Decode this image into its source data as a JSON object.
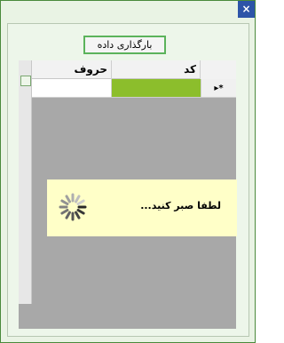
{
  "titlebar": {
    "close_symbol": "×"
  },
  "toolbar": {
    "load_data_label": "بارگذاری داده"
  },
  "grid": {
    "columns": [
      {
        "key": "code",
        "label": "کد"
      },
      {
        "key": "harf",
        "label": "حروف"
      }
    ],
    "new_row_indicator": "▸*"
  },
  "loading": {
    "message": "لطفا صبر کنید...",
    "icon": "spinner-icon"
  },
  "colors": {
    "window_border": "#4a8a3c",
    "close_button": "#2d54a8",
    "selected_cell": "#8cbe2c",
    "grid_background": "#a8a8a8",
    "wait_panel": "#ffffc8"
  }
}
